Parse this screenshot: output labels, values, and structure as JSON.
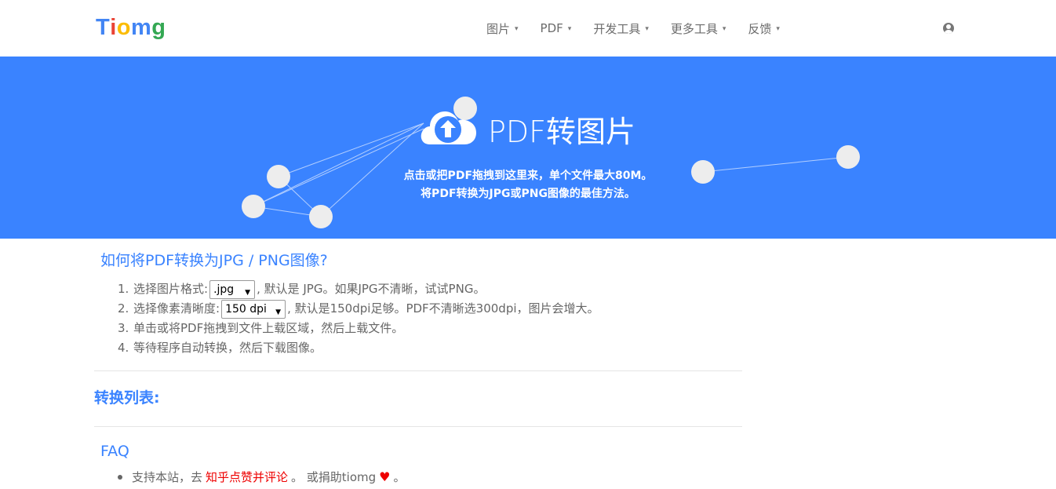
{
  "brand": {
    "logo_letters": [
      {
        "ch": "T",
        "color": "#4285f4"
      },
      {
        "ch": "i",
        "color": "#ea4335"
      },
      {
        "ch": "o",
        "color": "#fbbc05"
      },
      {
        "ch": "m",
        "color": "#4285f4"
      },
      {
        "ch": "g",
        "color": "#34a853"
      }
    ]
  },
  "nav": {
    "items": [
      {
        "label": "图片",
        "icon": "chevron-down-icon"
      },
      {
        "label": "PDF",
        "icon": "chevron-down-icon"
      },
      {
        "label": "开发工具",
        "icon": "chevron-down-icon"
      },
      {
        "label": "更多工具",
        "icon": "chevron-down-icon"
      },
      {
        "label": "反馈",
        "icon": "chevron-down-icon"
      }
    ],
    "user_icon": "user-icon"
  },
  "hero": {
    "title": "PDF转图片",
    "upload_icon": "cloud-upload-icon",
    "subtitle_line1": "点击或把PDF拖拽到这里来，单个文件最大80M。",
    "subtitle_line2": "将PDF转换为JPG或PNG图像的最佳方法。",
    "background_color": "#3a83ff"
  },
  "how": {
    "title": "如何将PDF转换为JPG / PNG图像?",
    "steps": [
      {
        "num": "1.",
        "prefix": "选择图片格式:",
        "select_value": ".jpg",
        "suffix": ", 默认是 JPG。如果JPG不清晰，试试PNG。"
      },
      {
        "num": "2.",
        "prefix": "选择像素清晰度:",
        "select_value": "150 dpi",
        "suffix": ", 默认是150dpi足够。PDF不清晰选300dpi，图片会增大。"
      },
      {
        "num": "3.",
        "text": "单击或将PDF拖拽到文件上载区域，然后上载文件。"
      },
      {
        "num": "4.",
        "text": "等待程序自动转换，然后下载图像。"
      }
    ]
  },
  "convert_list": {
    "title": "转换列表:"
  },
  "faq": {
    "title": "FAQ",
    "line_prefix": "支持本站，去",
    "link_text": "知乎点赞并评论",
    "line_middle": "。 或捐助tiomg",
    "heart_icon": "heart-icon",
    "line_end": "。"
  }
}
